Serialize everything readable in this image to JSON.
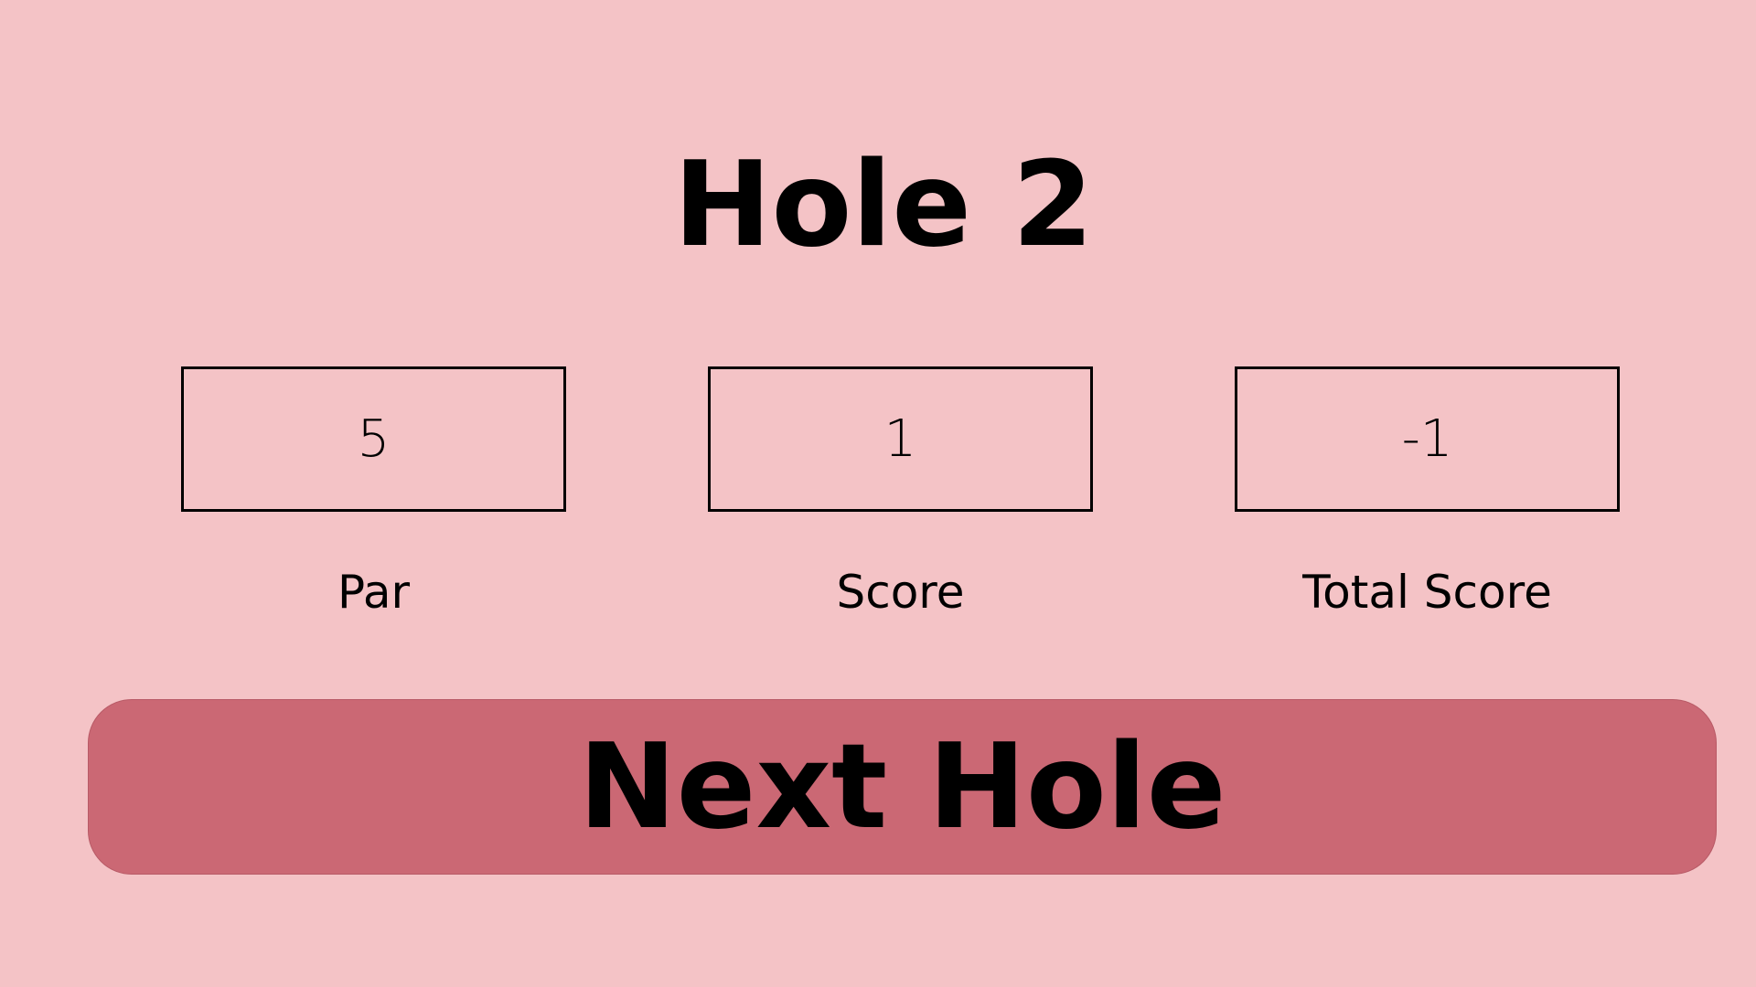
{
  "title": "Hole 2",
  "stats": {
    "par": {
      "value": "5",
      "label": "Par"
    },
    "score": {
      "value": "1",
      "label": "Score"
    },
    "total_score": {
      "value": "-1",
      "label": "Total Score"
    }
  },
  "next_button": {
    "label": "Next Hole"
  },
  "colors": {
    "background": "#f4c3c6",
    "button": "#cb6874",
    "text": "#000000"
  }
}
